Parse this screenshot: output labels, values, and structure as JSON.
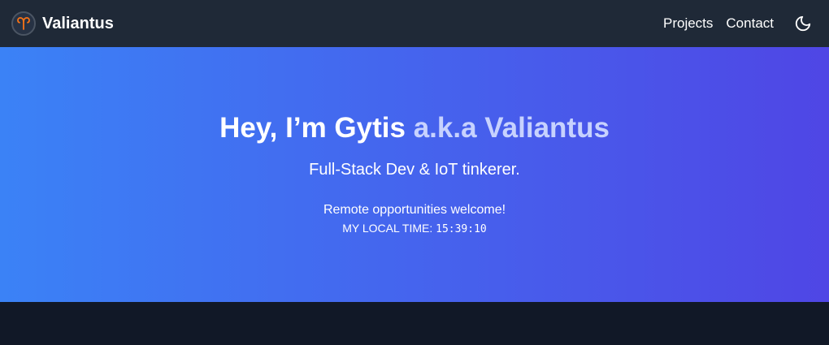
{
  "navbar": {
    "brand": "Valiantus",
    "logo_icon": "aries-icon",
    "links": [
      "Projects",
      "Contact"
    ],
    "theme_icon": "moon-icon"
  },
  "hero": {
    "title_main": "Hey, I’m Gytis",
    "title_alias": "a.k.a Valiantus",
    "subtitle": "Full-Stack Dev & IoT tinkerer.",
    "note": "Remote opportunities welcome!",
    "time_label": "MY LOCAL TIME:",
    "time_value": "15:39:10"
  },
  "colors": {
    "navbar_bg": "#1f2937",
    "page_bg": "#111827",
    "gradient_start": "#3b82f6",
    "gradient_end": "#4f46e5",
    "alias_text": "#c7d2fe",
    "logo_accent": "#f97316"
  }
}
